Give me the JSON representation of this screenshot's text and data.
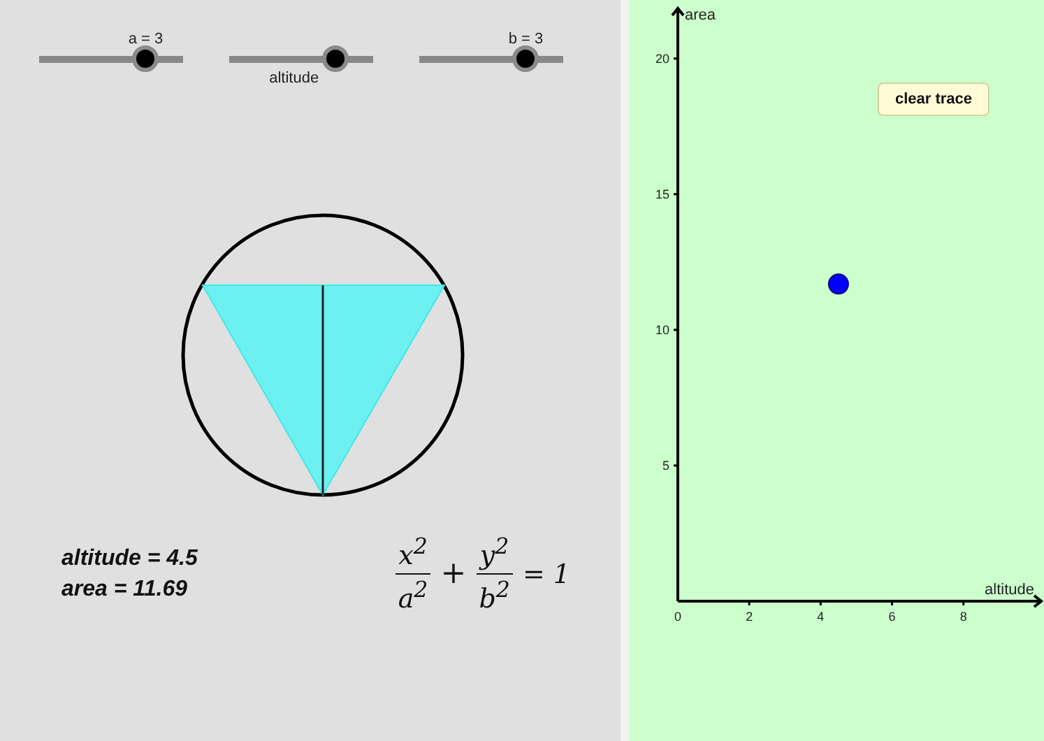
{
  "sliders": [
    {
      "top_label": "a = 3",
      "level": 0.74
    },
    {
      "bottom_label": "altitude",
      "level": 0.74
    },
    {
      "top_label": "b = 3",
      "level": 0.74
    }
  ],
  "readouts": [
    "altitude = 4.5",
    "area = 11.69"
  ],
  "equation": {
    "fractions": [
      {
        "numerator": "x$^{2}$",
        "denominator": "a$^{2}$"
      },
      {
        "numerator": "y$^{2}$",
        "denominator": "b$^{2}$"
      }
    ],
    "operator": "+",
    "right_side": "= 1"
  },
  "graph": {
    "button": "clear trace",
    "chart_data": {
      "type": "scatter",
      "xlabel": "altitude",
      "ylabel": "area",
      "x": [
        4.5
      ],
      "series": [
        {
          "color": "#0000ff",
          "values": [
            11.69
          ]
        }
      ],
      "xlim": [
        0,
        10.1
      ],
      "ylim": [
        0,
        21.9
      ],
      "xticks": [
        0,
        2,
        4,
        6,
        8
      ],
      "yticks": [
        5,
        10,
        15,
        20
      ]
    }
  }
}
